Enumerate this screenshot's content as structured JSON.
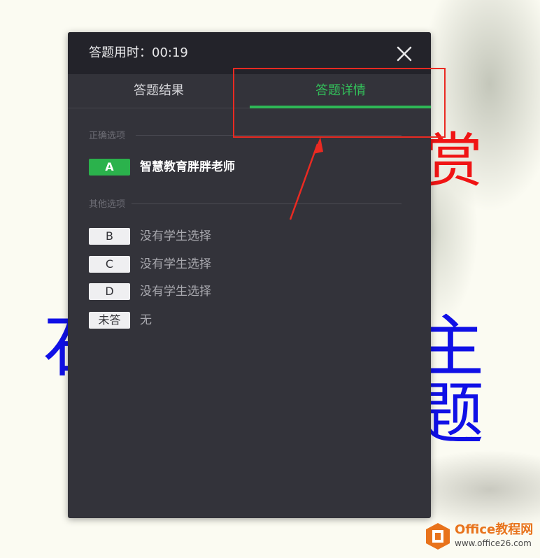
{
  "background": {
    "red_text": "赏",
    "blue_text_left": "石",
    "blue_text_right": "主题"
  },
  "dialog": {
    "timer_label": "答题用时：00:19",
    "close_icon": "close-icon",
    "tabs": [
      {
        "label": "答题结果",
        "active": false
      },
      {
        "label": "答题详情",
        "active": true
      }
    ],
    "accent_color": "#2eb856",
    "correct_section": {
      "label": "正确选项",
      "option": {
        "letter": "A",
        "text": "智慧教育胖胖老师"
      }
    },
    "other_section": {
      "label": "其他选项",
      "options": [
        {
          "letter": "B",
          "text": "没有学生选择"
        },
        {
          "letter": "C",
          "text": "没有学生选择"
        },
        {
          "letter": "D",
          "text": "没有学生选择"
        },
        {
          "letter": "未答",
          "text": "无"
        }
      ]
    }
  },
  "annotation": {
    "color": "#ea2a22"
  },
  "watermark": {
    "title": "Office教程网",
    "url": "www.office26.com"
  }
}
